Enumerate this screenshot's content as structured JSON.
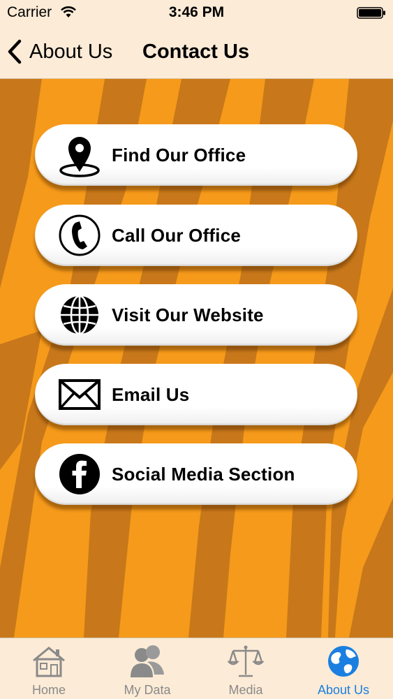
{
  "status_bar": {
    "carrier": "Carrier",
    "time": "3:46 PM"
  },
  "nav": {
    "back_label": "About Us",
    "title": "Contact Us"
  },
  "actions": [
    {
      "label": "Find Our Office",
      "icon": "map-pin-icon"
    },
    {
      "label": "Call Our Office",
      "icon": "phone-icon"
    },
    {
      "label": "Visit Our Website",
      "icon": "globe-icon"
    },
    {
      "label": "Email Us",
      "icon": "envelope-icon"
    },
    {
      "label": "Social Media Section",
      "icon": "facebook-icon"
    }
  ],
  "tabs": [
    {
      "label": "Home",
      "icon": "house-icon",
      "active": false
    },
    {
      "label": "My Data",
      "icon": "people-icon",
      "active": false
    },
    {
      "label": "Media",
      "icon": "scales-icon",
      "active": false
    },
    {
      "label": "About Us",
      "icon": "globe-icon",
      "active": true
    }
  ],
  "colors": {
    "accent": "#1a7fe0",
    "background_orange": "#f59a1a",
    "stripe_orange": "#c8781a",
    "bar_background": "#fcebd6"
  }
}
